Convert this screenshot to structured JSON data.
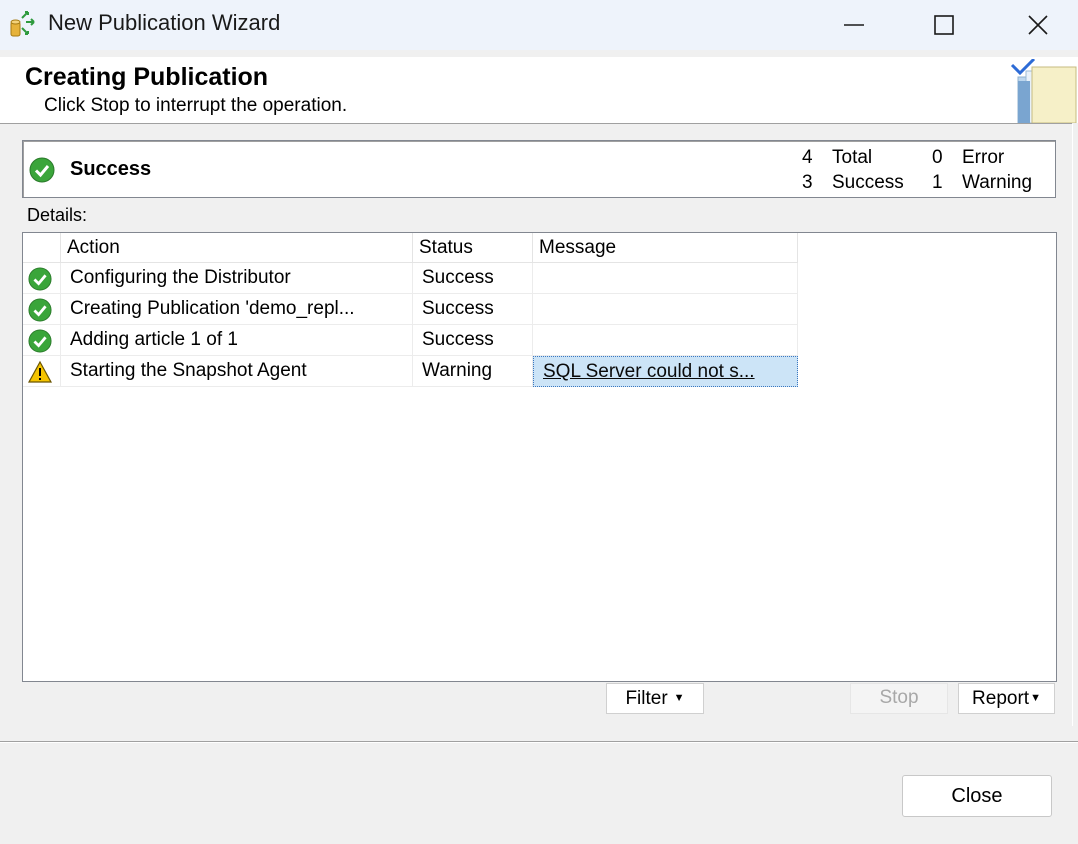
{
  "window": {
    "title": "New Publication Wizard",
    "buttons": [
      "minimize-icon",
      "maximize-icon",
      "close-icon"
    ]
  },
  "header": {
    "title": "Creating Publication",
    "subtitle": "Click Stop to interrupt the operation."
  },
  "summary": {
    "status": "Success",
    "status_icon": "success-check-icon",
    "counts": {
      "total_value": "4",
      "total_label": "Total",
      "success_value": "3",
      "success_label": "Success",
      "error_value": "0",
      "error_label": "Error",
      "warning_value": "1",
      "warning_label": "Warning"
    }
  },
  "details_label": "Details:",
  "grid": {
    "columns": [
      "Action",
      "Status",
      "Message"
    ],
    "rows": [
      {
        "icon": "success-check-icon",
        "action": "Configuring the Distributor",
        "status": "Success",
        "message": ""
      },
      {
        "icon": "success-check-icon",
        "action": "Creating Publication 'demo_repl...",
        "status": "Success",
        "message": ""
      },
      {
        "icon": "success-check-icon",
        "action": "Adding article 1 of 1",
        "status": "Success",
        "message": ""
      },
      {
        "icon": "warning-triangle-icon",
        "action": "Starting the Snapshot Agent",
        "status": "Warning",
        "message": "SQL Server could not s..."
      }
    ]
  },
  "buttons": {
    "filter": "Filter",
    "stop": "Stop",
    "report": "Report",
    "close": "Close"
  },
  "colors": {
    "success": "#3aa53a",
    "warning": "#f5c400",
    "selection": "#cce4f7",
    "titlebar": "#eef3fb"
  }
}
